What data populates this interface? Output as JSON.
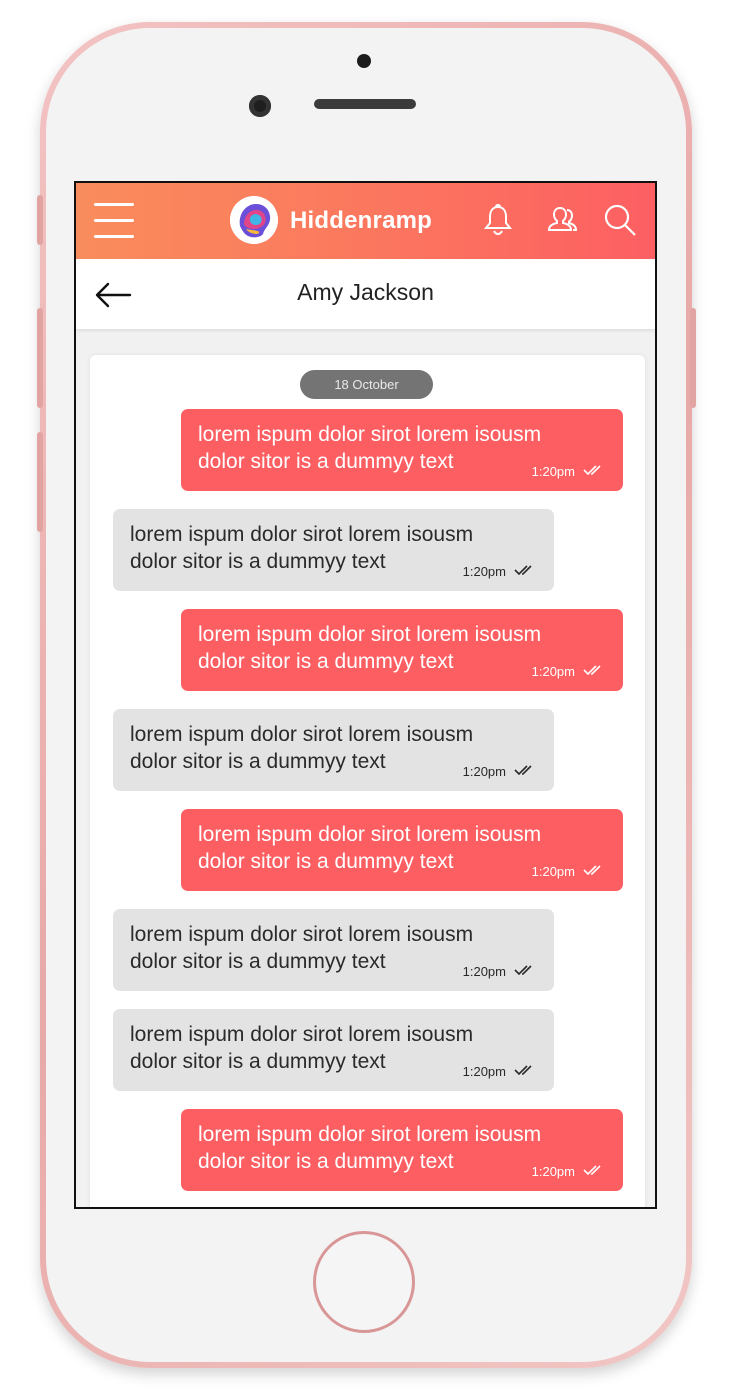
{
  "app": {
    "title": "Hiddenramp"
  },
  "header": {
    "icons": [
      "menu-icon",
      "bell-icon",
      "contacts-icon",
      "search-icon"
    ],
    "contact_name": "Amy Jackson"
  },
  "chat": {
    "date_label": "18 October",
    "messages": [
      {
        "direction": "out",
        "text": "lorem ispum dolor sirot lorem isousm\ndolor sitor is a dummyy text",
        "time": "1:20pm",
        "status": "read"
      },
      {
        "direction": "in",
        "text": "lorem ispum dolor sirot lorem isousm\ndolor sitor is a dummyy text",
        "time": "1:20pm",
        "status": "read"
      },
      {
        "direction": "out",
        "text": "lorem ispum dolor sirot lorem isousm\ndolor sitor is a dummyy text",
        "time": "1:20pm",
        "status": "read"
      },
      {
        "direction": "in",
        "text": "lorem ispum dolor sirot lorem isousm\ndolor sitor is a dummyy text",
        "time": "1:20pm",
        "status": "read"
      },
      {
        "direction": "out",
        "text": "lorem ispum dolor sirot lorem isousm\ndolor sitor is a dummyy text",
        "time": "1:20pm",
        "status": "read"
      },
      {
        "direction": "in",
        "text": "lorem ispum dolor sirot lorem isousm\ndolor sitor is a dummyy text",
        "time": "1:20pm",
        "status": "read"
      },
      {
        "direction": "in",
        "text": "lorem ispum dolor sirot lorem isousm\ndolor sitor is a dummyy text",
        "time": "1:20pm",
        "status": "read"
      },
      {
        "direction": "out",
        "text": "lorem ispum dolor sirot lorem isousm\ndolor sitor is a dummyy text",
        "time": "1:20pm",
        "status": "read"
      }
    ]
  },
  "colors": {
    "header_gradient_start": "#f98c5c",
    "header_gradient_end": "#fd5f62",
    "outgoing_bubble": "#fd5e62",
    "incoming_bubble": "#e3e3e3",
    "date_pill": "#747474"
  }
}
